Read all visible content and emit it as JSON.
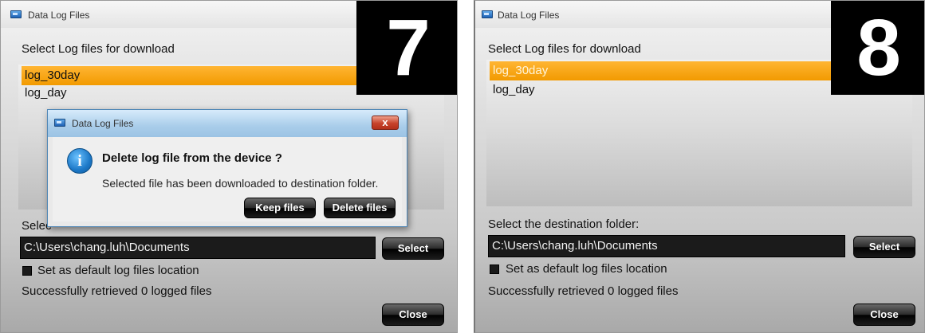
{
  "step7": {
    "step_number": "7",
    "window_title": "Data Log Files",
    "select_label": "Select Log files for download",
    "files": [
      {
        "name": "log_30day",
        "selected": true
      },
      {
        "name": "log_day",
        "selected": false
      }
    ],
    "destination_label_partial": "Selec",
    "destination_path": "C:\\Users\\chang.luh\\Documents",
    "select_button": "Select",
    "default_checkbox_label": "Set as default log files location",
    "status_text": "Successfully retrieved 0 logged files",
    "close_button": "Close",
    "dialog": {
      "title": "Data Log Files",
      "close_glyph": "x",
      "icon": "info-icon",
      "icon_glyph": "i",
      "heading": "Delete log file from the device ?",
      "message": "Selected file has been downloaded to destination folder.",
      "keep_button": "Keep files",
      "delete_button": "Delete files"
    }
  },
  "step8": {
    "step_number": "8",
    "window_title": "Data Log Files",
    "select_label": "Select Log files for download",
    "files": [
      {
        "name": "log_30day",
        "selected": true
      },
      {
        "name": "log_day",
        "selected": false
      }
    ],
    "destination_label": "Select the destination folder:",
    "destination_path": "C:\\Users\\chang.luh\\Documents",
    "select_button": "Select",
    "default_checkbox_label": "Set as default log files location",
    "status_text": "Successfully retrieved 0 logged files",
    "close_button": "Close"
  },
  "colors": {
    "selection": "#f29a00",
    "dark_field": "#1b1b1b",
    "dialog_border": "#4f86b6"
  }
}
